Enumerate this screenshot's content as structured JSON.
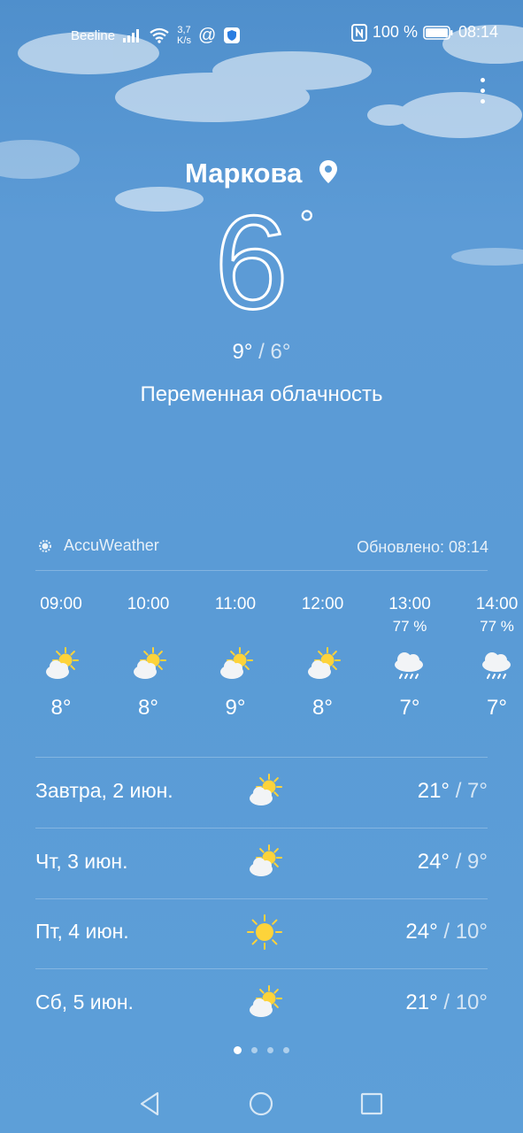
{
  "status_bar": {
    "carrier": "Beeline",
    "speed_value": "3,7",
    "speed_unit": "K/s",
    "battery": "100 %",
    "time": "08:14"
  },
  "header": {
    "city": "Маркова",
    "temperature": "6",
    "degree_mark": "°",
    "high": "9°",
    "separator": "/",
    "low": "6°",
    "condition": "Переменная облачность"
  },
  "provider": {
    "name": "AccuWeather",
    "updated": "Обновлено: 08:14"
  },
  "hourly": [
    {
      "time": "09:00",
      "precip": "",
      "icon": "partly-cloudy-icon",
      "temp": "8°"
    },
    {
      "time": "10:00",
      "precip": "",
      "icon": "partly-cloudy-icon",
      "temp": "8°"
    },
    {
      "time": "11:00",
      "precip": "",
      "icon": "partly-cloudy-icon",
      "temp": "9°"
    },
    {
      "time": "12:00",
      "precip": "",
      "icon": "partly-cloudy-icon",
      "temp": "8°"
    },
    {
      "time": "13:00",
      "precip": "77 %",
      "icon": "rain-cloud-icon",
      "temp": "7°"
    },
    {
      "time": "14:00",
      "precip": "77 %",
      "icon": "rain-cloud-icon",
      "temp": "7°"
    }
  ],
  "daily": [
    {
      "day": "Завтра, 2 июн.",
      "icon": "partly-cloudy-icon",
      "high": "21°",
      "sep": " / ",
      "low": "7°"
    },
    {
      "day": "Чт, 3 июн.",
      "icon": "partly-cloudy-icon",
      "high": "24°",
      "sep": " / ",
      "low": "9°"
    },
    {
      "day": "Пт, 4 июн.",
      "icon": "sun-icon",
      "high": "24°",
      "sep": " / ",
      "low": "10°"
    },
    {
      "day": "Сб, 5 июн.",
      "icon": "partly-cloudy-icon",
      "high": "21°",
      "sep": " / ",
      "low": "10°"
    }
  ],
  "pages": {
    "count": 4,
    "active": 0
  },
  "colors": {
    "sky": "#5a9bd6",
    "sun": "#fdd33a",
    "text": "#ffffff"
  }
}
